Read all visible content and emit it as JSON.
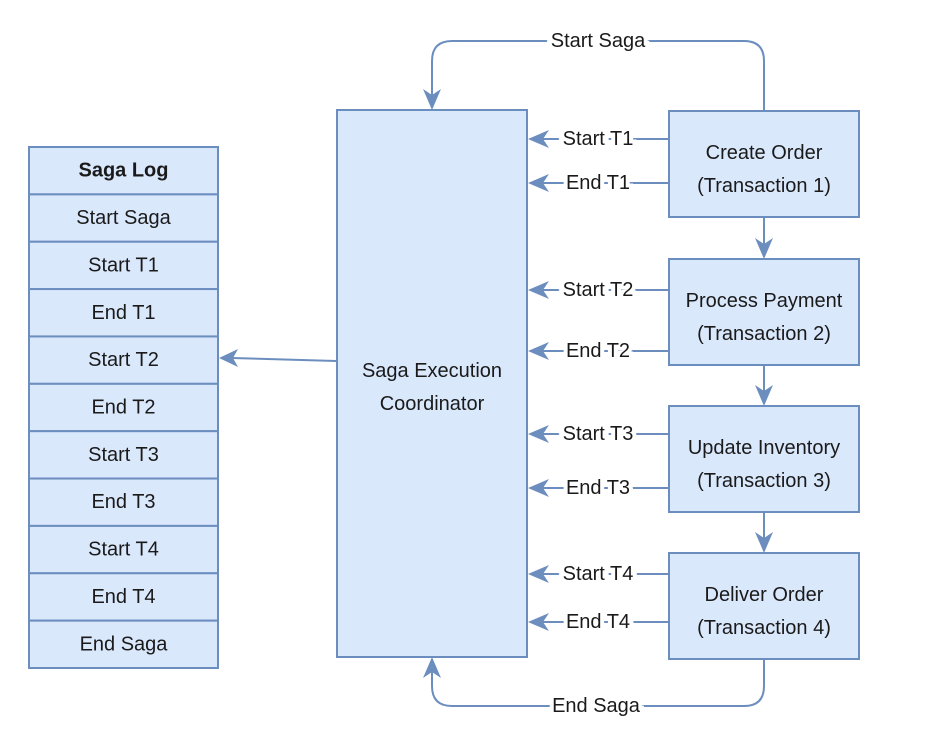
{
  "colors": {
    "fill": "#dae8fc",
    "stroke": "#6c8ebf"
  },
  "saga_log": {
    "title": "Saga Log",
    "entries": [
      "Start Saga",
      "Start T1",
      "End T1",
      "Start T2",
      "End T2",
      "Start T3",
      "End T3",
      "Start T4",
      "End T4",
      "End Saga"
    ]
  },
  "coordinator": {
    "line1": "Saga Execution",
    "line2": "Coordinator"
  },
  "transactions": [
    {
      "name": "Create Order",
      "sub": "(Transaction 1)",
      "start": "Start T1",
      "end": "End T1"
    },
    {
      "name": "Process Payment",
      "sub": "(Transaction 2)",
      "start": "Start T2",
      "end": "End T2"
    },
    {
      "name": "Update Inventory",
      "sub": "(Transaction 3)",
      "start": "Start T3",
      "end": "End T3"
    },
    {
      "name": "Deliver Order",
      "sub": "(Transaction 4)",
      "start": "Start T4",
      "end": "End T4"
    }
  ],
  "loops": {
    "start": "Start Saga",
    "end": "End Saga"
  }
}
